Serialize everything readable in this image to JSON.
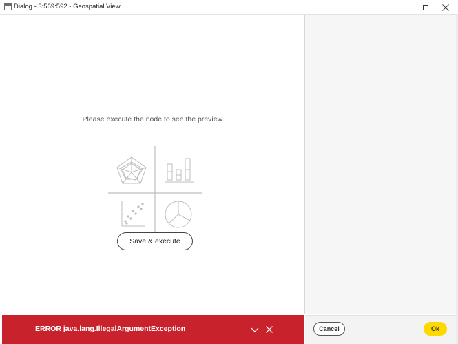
{
  "window": {
    "title": "Dialog - 3:569:592 - Geospatial View",
    "controls": {
      "minimize": "minimize",
      "maximize": "maximize",
      "close": "close"
    }
  },
  "main": {
    "preview_message": "Please execute the node to see the preview.",
    "illustration_icons": [
      "radar-chart-icon",
      "bar-chart-icon",
      "scatter-plot-icon",
      "pie-chart-icon"
    ],
    "save_execute_label": "Save & execute"
  },
  "error_bar": {
    "message": "ERROR java.lang.IllegalArgumentException",
    "color": "#c8232c"
  },
  "footer": {
    "cancel_label": "Cancel",
    "ok_label": "Ok",
    "ok_color": "#ffd800"
  }
}
